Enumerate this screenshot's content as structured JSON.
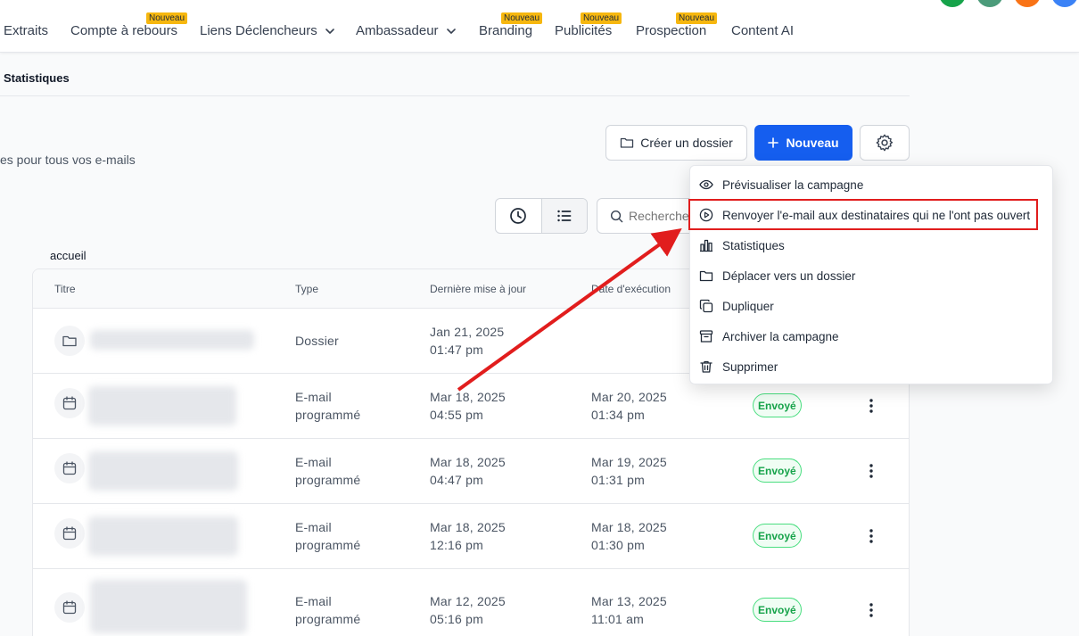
{
  "nav": {
    "items": [
      {
        "label": "Extraits",
        "badge": ""
      },
      {
        "label": "Compte à rebours",
        "badge": "Nouveau"
      },
      {
        "label": "Liens Déclencheurs",
        "badge": ""
      },
      {
        "label": "Ambassadeur",
        "badge": ""
      },
      {
        "label": "Branding",
        "badge": "Nouveau"
      },
      {
        "label": "Publicités",
        "badge": "Nouveau"
      },
      {
        "label": "Prospection",
        "badge": "Nouveau"
      },
      {
        "label": "Content AI",
        "badge": ""
      }
    ],
    "avatar_colors": [
      "#16a34a",
      "#4b9b7a",
      "#f97316",
      "#3b82f6"
    ]
  },
  "subheader": {
    "tab": "Statistiques"
  },
  "page": {
    "subtitle": "es pour tous vos e-mails"
  },
  "actions": {
    "create_folder": "Créer un dossier",
    "new": "Nouveau",
    "search_placeholder": "Recherche"
  },
  "breadcrumb": "accueil",
  "table": {
    "headers": [
      "Titre",
      "Type",
      "Dernière mise à jour",
      "Date d'exécution"
    ],
    "rows": [
      {
        "icon": "folder-icon",
        "type": "Dossier",
        "updated": [
          "Jan 21, 2025",
          "01:47 pm"
        ],
        "executed": [
          "",
          ""
        ],
        "status": ""
      },
      {
        "icon": "calendar-icon",
        "type": "E-mail programmé",
        "updated": [
          "Mar 18, 2025",
          "04:55 pm"
        ],
        "executed": [
          "Mar 20, 2025",
          "01:34 pm"
        ],
        "status": "Envoyé"
      },
      {
        "icon": "calendar-icon",
        "type": "E-mail programmé",
        "updated": [
          "Mar 18, 2025",
          "04:47 pm"
        ],
        "executed": [
          "Mar 19, 2025",
          "01:31 pm"
        ],
        "status": "Envoyé"
      },
      {
        "icon": "calendar-icon",
        "type": "E-mail programmé",
        "updated": [
          "Mar 18, 2025",
          "12:16 pm"
        ],
        "executed": [
          "Mar 18, 2025",
          "01:30 pm"
        ],
        "status": "Envoyé"
      },
      {
        "icon": "calendar-icon",
        "type": "E-mail programmé",
        "updated": [
          "Mar 12, 2025",
          "05:16 pm"
        ],
        "executed": [
          "Mar 13, 2025",
          "11:01 am"
        ],
        "status": "Envoyé"
      }
    ]
  },
  "menu": {
    "items": [
      {
        "label": "Prévisualiser la campagne",
        "icon": "eye-icon"
      },
      {
        "label": "Renvoyer l'e-mail aux destinataires qui ne l'ont pas ouvert",
        "icon": "play-circle-icon"
      },
      {
        "label": "Statistiques",
        "icon": "bar-chart-icon"
      },
      {
        "label": "Déplacer vers un dossier",
        "icon": "folder-icon"
      },
      {
        "label": "Dupliquer",
        "icon": "copy-icon"
      },
      {
        "label": "Archiver la campagne",
        "icon": "archive-icon"
      },
      {
        "label": "Supprimer",
        "icon": "trash-icon"
      }
    ]
  },
  "colors": {
    "primary": "#155eef",
    "badge": "#f6b70f",
    "success": "#16a34a",
    "annotation": "#e11d1d"
  }
}
